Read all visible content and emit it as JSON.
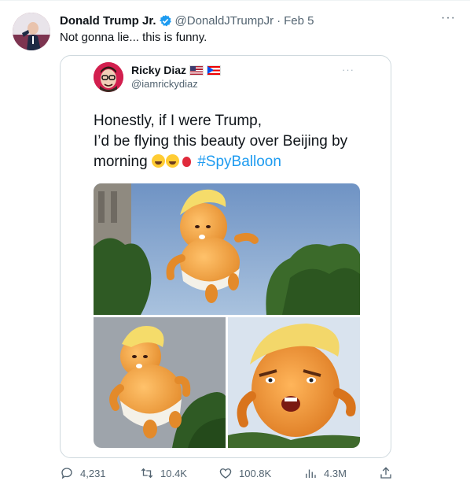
{
  "tweet": {
    "author_name": "Donald Trump Jr.",
    "handle": "@DonaldJTrumpJr",
    "separator": "·",
    "date": "Feb 5",
    "more": "···",
    "text": "Not gonna lie... this is funny."
  },
  "quote": {
    "author_name": "Ricky Diaz",
    "handle": "@iamrickydiaz",
    "more": "···",
    "text_line1": "Honestly, if I were Trump,",
    "text_line2": "I’d be flying this beauty over Beijing by",
    "text_line3": "morning",
    "hashtag": "#SpyBalloon"
  },
  "actions": {
    "replies": "4,231",
    "retweets": "10.4K",
    "likes": "100.8K",
    "views": "4.3M"
  },
  "colors": {
    "accent": "#1d9bf0",
    "secondary_text": "#536471",
    "border": "#cfd9de"
  },
  "icons": [
    "verified-badge-icon",
    "more-icon",
    "reply-icon",
    "retweet-icon",
    "like-icon",
    "views-icon",
    "share-icon"
  ]
}
